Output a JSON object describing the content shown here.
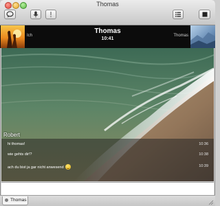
{
  "window": {
    "title": "Thomas"
  },
  "toolbar": {
    "icons": [
      "chat-bubble-icon",
      "microphone-icon",
      "alert-icon",
      "list-icon",
      "stop-icon"
    ]
  },
  "header": {
    "my_label": "Ich",
    "contact_name": "Thomas",
    "time": "10:41",
    "contact_label": "Thomas"
  },
  "conversation": {
    "sender": "Robert",
    "messages": [
      {
        "text": "hi thomas!",
        "time": "10:36"
      },
      {
        "text": "wie gehts dir!?",
        "time": "10:38"
      },
      {
        "text": "ach du bist ja gar nicht anwesend",
        "time": "10:39",
        "emoji": "smiley-icon"
      }
    ]
  },
  "input": {
    "value": ""
  },
  "tabs": [
    {
      "label": "Thomas",
      "status": "offline"
    }
  ],
  "colors": {
    "header_bg": "#0c0c0c",
    "titlebar_top": "#ececec",
    "titlebar_bottom": "#c7c7c7",
    "message_overlay": "#262626"
  }
}
